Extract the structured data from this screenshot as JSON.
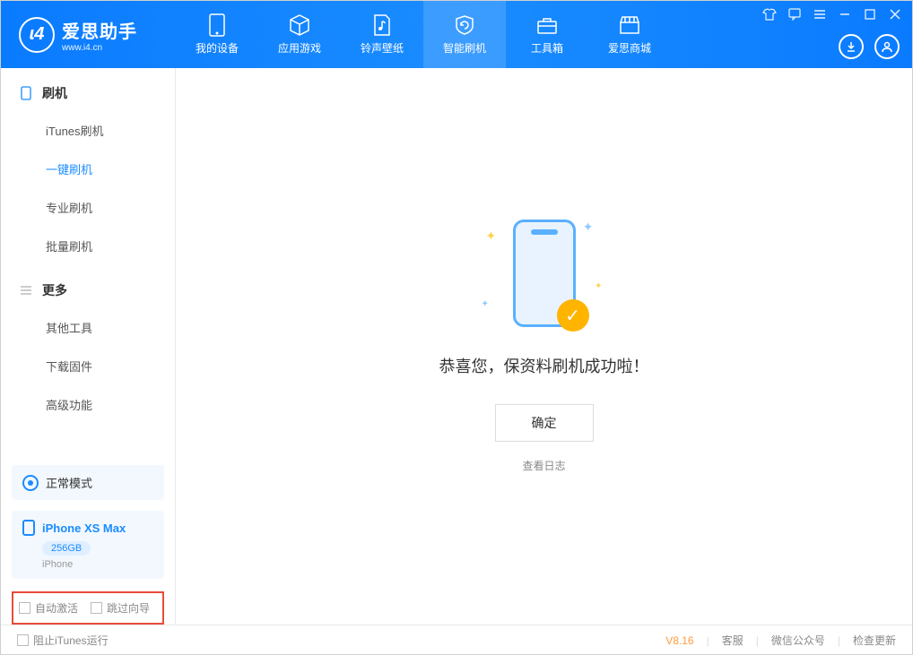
{
  "app": {
    "title": "爱思助手",
    "subtitle": "www.i4.cn"
  },
  "nav": {
    "items": [
      {
        "label": "我的设备"
      },
      {
        "label": "应用游戏"
      },
      {
        "label": "铃声壁纸"
      },
      {
        "label": "智能刷机"
      },
      {
        "label": "工具箱"
      },
      {
        "label": "爱思商城"
      }
    ]
  },
  "sidebar": {
    "section1": {
      "title": "刷机",
      "items": [
        "iTunes刷机",
        "一键刷机",
        "专业刷机",
        "批量刷机"
      ]
    },
    "section2": {
      "title": "更多",
      "items": [
        "其他工具",
        "下载固件",
        "高级功能"
      ]
    },
    "mode_label": "正常模式",
    "device": {
      "name": "iPhone XS Max",
      "storage": "256GB",
      "type": "iPhone"
    },
    "checkboxes": {
      "auto_activate": "自动激活",
      "skip_guide": "跳过向导"
    }
  },
  "main": {
    "success_message": "恭喜您，保资料刷机成功啦！",
    "ok_button": "确定",
    "view_log": "查看日志"
  },
  "footer": {
    "block_itunes": "阻止iTunes运行",
    "version": "V8.16",
    "links": [
      "客服",
      "微信公众号",
      "检查更新"
    ]
  }
}
